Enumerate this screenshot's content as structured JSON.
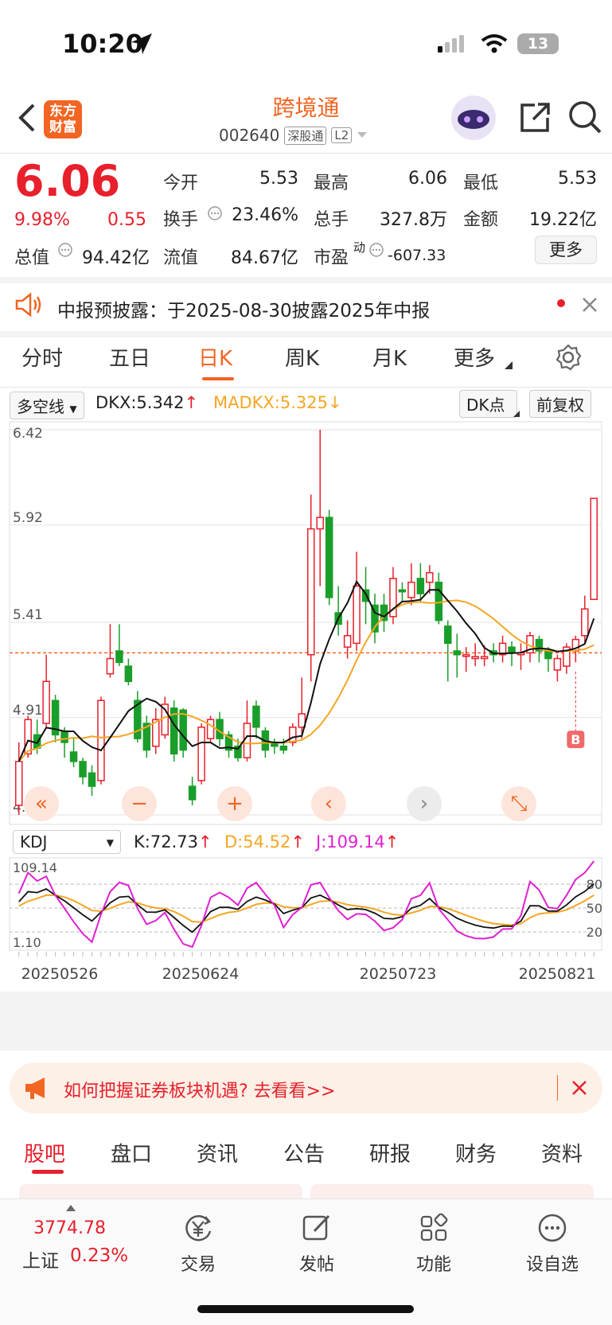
{
  "status": {
    "time": "10:20",
    "battery": "13"
  },
  "header": {
    "logo_line1": "东方",
    "logo_line2": "财富",
    "title": "跨境通",
    "code": "002640",
    "tag1": "深股通",
    "tag2": "L2"
  },
  "quote": {
    "price": "6.06",
    "pct": "9.98%",
    "change": "0.55",
    "open_label": "今开",
    "open": "5.53",
    "high_label": "最高",
    "high": "6.06",
    "low_label": "最低",
    "low": "5.53",
    "turnover_label": "换手",
    "turnover": "23.46%",
    "volume_label": "总手",
    "volume": "327.8万",
    "amount_label": "金额",
    "amount": "19.22亿",
    "mcap_label": "总值",
    "mcap": "94.42亿",
    "float_label": "流值",
    "float": "84.67亿",
    "pe_label": "市盈",
    "pe_sup": "动",
    "pe": "-607.33",
    "more": "更多"
  },
  "notice": {
    "text": "中报预披露：于2025-08-30披露2025年中报"
  },
  "tabs": [
    "分时",
    "五日",
    "日K",
    "周K",
    "月K",
    "更多"
  ],
  "toolbar": {
    "indicator": "多空线",
    "dkx": "DKX:5.342",
    "madkx": "MADKX:5.325",
    "dk_points": "DK点",
    "adjust": "前复权"
  },
  "kdj": {
    "selector": "KDJ",
    "k": "K:72.73",
    "d": "D:54.52",
    "j": "J:109.14"
  },
  "chart_data": {
    "type": "candlestick",
    "y_ticks": [
      "6.42",
      "5.92",
      "5.41",
      "4.91",
      "4.40"
    ],
    "ylim": [
      4.4,
      6.42
    ],
    "kdj_ticks": [
      "109.14",
      "1.10"
    ],
    "kdj_right_ticks": [
      "80",
      "50",
      "20"
    ],
    "x_labels": [
      "20250526",
      "20250624",
      "20250723",
      "20250821"
    ],
    "marker": "B",
    "ohlc": [
      [
        4.45,
        4.68,
        4.4,
        4.78
      ],
      [
        4.72,
        4.9,
        4.7,
        4.92
      ],
      [
        4.82,
        4.75,
        4.72,
        4.9
      ],
      [
        4.88,
        5.1,
        4.86,
        5.24
      ],
      [
        5.0,
        4.82,
        4.78,
        5.03
      ],
      [
        4.84,
        4.78,
        4.7,
        4.86
      ],
      [
        4.73,
        4.68,
        4.65,
        4.8
      ],
      [
        4.68,
        4.6,
        4.56,
        4.7
      ],
      [
        4.62,
        4.55,
        4.5,
        4.66
      ],
      [
        4.58,
        5.0,
        4.56,
        5.02
      ],
      [
        5.14,
        5.22,
        5.12,
        5.4
      ],
      [
        5.26,
        5.2,
        5.18,
        5.4
      ],
      [
        5.18,
        5.1,
        5.08,
        5.22
      ],
      [
        5.0,
        4.8,
        4.78,
        5.05
      ],
      [
        4.88,
        4.74,
        4.7,
        4.92
      ],
      [
        4.76,
        4.9,
        4.72,
        4.96
      ],
      [
        4.82,
        4.98,
        4.8,
        5.02
      ],
      [
        4.96,
        4.72,
        4.68,
        5.0
      ],
      [
        4.95,
        4.74,
        4.7,
        4.96
      ],
      [
        4.55,
        4.48,
        4.45,
        4.6
      ],
      [
        4.58,
        4.86,
        4.56,
        4.88
      ],
      [
        4.8,
        4.9,
        4.78,
        4.92
      ],
      [
        4.9,
        4.8,
        4.76,
        4.94
      ],
      [
        4.82,
        4.74,
        4.7,
        4.84
      ],
      [
        4.76,
        4.7,
        4.68,
        4.8
      ],
      [
        4.7,
        4.88,
        4.68,
        5.0
      ],
      [
        4.97,
        4.86,
        4.8,
        5.0
      ],
      [
        4.84,
        4.74,
        4.7,
        4.86
      ],
      [
        4.78,
        4.76,
        4.72,
        4.8
      ],
      [
        4.76,
        4.74,
        4.72,
        4.8
      ],
      [
        4.78,
        4.86,
        4.76,
        4.88
      ],
      [
        4.86,
        4.93,
        4.8,
        5.12
      ],
      [
        5.24,
        5.9,
        5.1,
        6.08
      ],
      [
        5.9,
        5.96,
        5.6,
        6.42
      ],
      [
        5.96,
        5.54,
        5.5,
        6.0
      ],
      [
        5.46,
        5.4,
        5.34,
        5.6
      ],
      [
        5.28,
        5.34,
        5.22,
        5.42
      ],
      [
        5.3,
        5.6,
        5.26,
        5.78
      ],
      [
        5.58,
        5.52,
        5.4,
        5.7
      ],
      [
        5.5,
        5.36,
        5.3,
        5.56
      ],
      [
        5.5,
        5.42,
        5.36,
        5.56
      ],
      [
        5.44,
        5.64,
        5.4,
        5.7
      ],
      [
        5.58,
        5.57,
        5.52,
        5.62
      ],
      [
        5.54,
        5.62,
        5.5,
        5.72
      ],
      [
        5.64,
        5.56,
        5.52,
        5.72
      ],
      [
        5.62,
        5.67,
        5.56,
        5.71
      ],
      [
        5.62,
        5.42,
        5.4,
        5.67
      ],
      [
        5.39,
        5.3,
        5.1,
        5.42
      ],
      [
        5.26,
        5.24,
        5.12,
        5.35
      ],
      [
        5.24,
        5.24,
        5.15,
        5.28
      ],
      [
        5.22,
        5.23,
        5.18,
        5.3
      ],
      [
        5.22,
        5.23,
        5.18,
        5.29
      ],
      [
        5.26,
        5.24,
        5.2,
        5.3
      ],
      [
        5.24,
        5.3,
        5.2,
        5.34
      ],
      [
        5.28,
        5.25,
        5.18,
        5.31
      ],
      [
        5.24,
        5.25,
        5.16,
        5.3
      ],
      [
        5.25,
        5.34,
        5.2,
        5.36
      ],
      [
        5.32,
        5.26,
        5.2,
        5.34
      ],
      [
        5.26,
        5.22,
        5.15,
        5.28
      ],
      [
        5.16,
        5.22,
        5.1,
        5.24
      ],
      [
        5.18,
        5.28,
        5.14,
        5.3
      ],
      [
        5.26,
        5.32,
        5.2,
        5.34
      ],
      [
        5.34,
        5.48,
        5.3,
        5.55
      ],
      [
        5.53,
        6.06,
        5.53,
        6.06
      ]
    ]
  },
  "banner": {
    "text": "如何把握证券板块机遇? 去看看>>"
  },
  "bottom_tabs": [
    "股吧",
    "盘口",
    "资讯",
    "公告",
    "研报",
    "财务",
    "资料"
  ],
  "bottom_bar": {
    "index_value": "3774.78",
    "index_name": "上证",
    "index_pct": "0.23%",
    "trade": "交易",
    "post": "发帖",
    "func": "功能",
    "watch": "设自选"
  }
}
